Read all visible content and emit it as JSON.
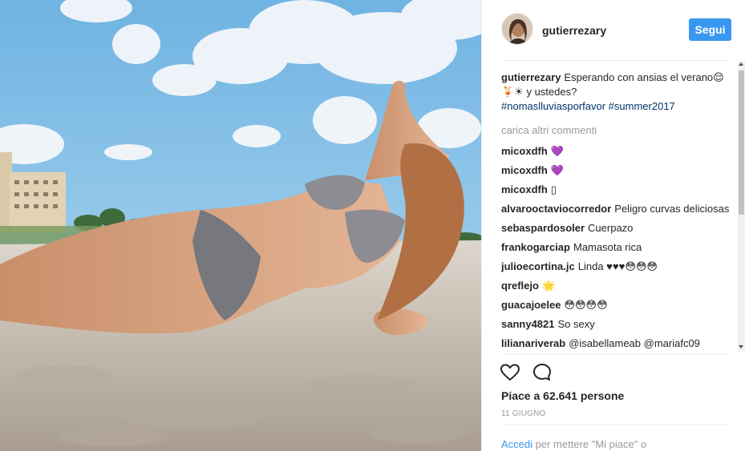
{
  "post": {
    "author": "gutierrezary",
    "follow_label": "Segui",
    "caption": {
      "username": "gutierrezary",
      "text": "Esperando con ansias el verano😌🍹☀ y ustedes?",
      "hashtags": "#nomaslluviasporfavor #summer2017"
    },
    "load_more": "carica altri commenti",
    "comments": [
      {
        "user": "micoxdfh",
        "text": "💜"
      },
      {
        "user": "micoxdfh",
        "text": "💜"
      },
      {
        "user": "micoxdfh",
        "text": "▯"
      },
      {
        "user": "alvarooctaviocorredor",
        "text": "Peligro curvas deliciosas"
      },
      {
        "user": "sebaspardosoler",
        "text": "Cuerpazo"
      },
      {
        "user": "frankogarciap",
        "text": "Mamasota rica"
      },
      {
        "user": "julioecortina.jc",
        "text": "Linda ♥♥♥😳😳😳"
      },
      {
        "user": "qreflejo",
        "text": "🌟"
      },
      {
        "user": "guacajoelee",
        "text": "😳😳😳😳"
      },
      {
        "user": "sanny4821",
        "text": "So sexy"
      },
      {
        "user": "lilianariverab",
        "text": "@isabellameab @mariafc09"
      }
    ],
    "likes": "Piace a 62.641 persone",
    "date": "11 GIUGNO",
    "login_link": "Accedi",
    "login_rest": "per mettere \"Mi piace\" o"
  },
  "icons": {
    "like": "heart-outline-icon",
    "comment": "speech-bubble-icon"
  },
  "colors": {
    "follow_button": "#3897f0",
    "hashtag": "#003569",
    "link": "#3897f0",
    "muted": "#999999"
  }
}
